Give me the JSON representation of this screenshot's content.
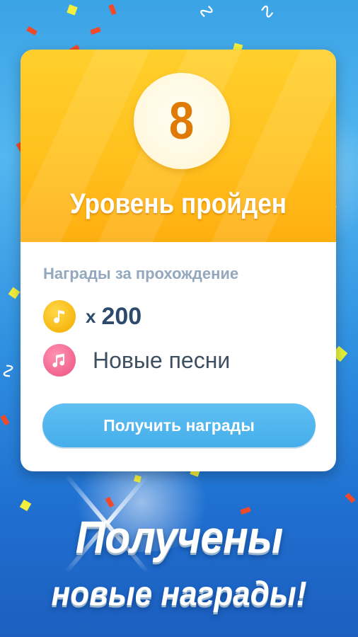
{
  "level": {
    "number": "8",
    "title": "Уровень пройден"
  },
  "rewards": {
    "heading": "Награды за прохождение",
    "coins": {
      "icon": "music-note-coin-icon",
      "multiplier": "x",
      "amount": "200"
    },
    "songs": {
      "icon": "music-note-icon",
      "label": "Новые песни"
    }
  },
  "claim_button": {
    "label": "Получить награды"
  },
  "promo": {
    "line1": "Получены",
    "line2": "новые награды!"
  },
  "colors": {
    "header_yellow": "#ffc11e",
    "level_number": "#e07a06",
    "button_blue": "#45aeea",
    "coin_gold": "#f7b812",
    "song_pink": "#f2648f",
    "background_blue": "#2f8fe0"
  }
}
